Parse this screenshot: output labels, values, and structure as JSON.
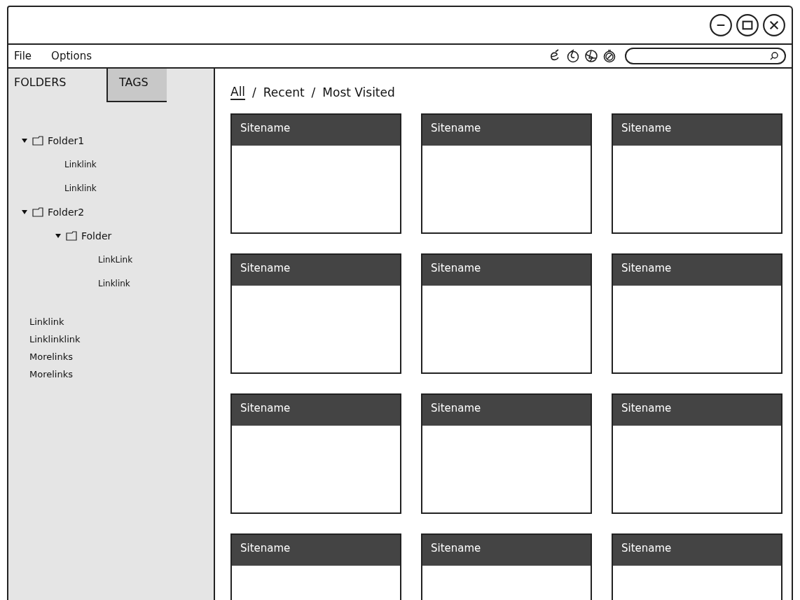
{
  "menu": [
    "File",
    "Options"
  ],
  "sidebar": {
    "tabs": [
      {
        "label": "FOLDERS",
        "selected": true
      },
      {
        "label": "TAGS",
        "selected": false
      }
    ],
    "tree": [
      {
        "kind": "folder",
        "label": "Folder1",
        "expanded": true,
        "children": [
          {
            "kind": "link",
            "label": "Linklink"
          },
          {
            "kind": "link",
            "label": "Linklink"
          }
        ]
      },
      {
        "kind": "folder",
        "label": "Folder2",
        "expanded": true,
        "children": [
          {
            "kind": "folder",
            "label": "Folder",
            "expanded": true,
            "children": [
              {
                "kind": "link",
                "label": "LinkLink"
              },
              {
                "kind": "link",
                "label": "Linklink"
              }
            ]
          }
        ]
      }
    ],
    "links": [
      "Linklink",
      "Linklinklink",
      "Morelinks",
      "Morelinks"
    ]
  },
  "filters": [
    {
      "kind": "tab",
      "label": "All",
      "selected": true
    },
    {
      "kind": "separator",
      "label": "/"
    },
    {
      "kind": "tab",
      "label": "Recent",
      "selected": false
    },
    {
      "kind": "separator",
      "label": "/"
    },
    {
      "kind": "tab",
      "label": "Most Visited",
      "selected": false
    }
  ],
  "sites": [
    {
      "title": "Sitename"
    },
    {
      "title": "Sitename"
    },
    {
      "title": "Sitename"
    },
    {
      "title": "Sitename"
    },
    {
      "title": "Sitename"
    },
    {
      "title": "Sitename"
    },
    {
      "title": "Sitename"
    },
    {
      "title": "Sitename"
    },
    {
      "title": "Sitename"
    },
    {
      "title": "Sitename"
    },
    {
      "title": "Sitename"
    },
    {
      "title": "Sitename"
    }
  ]
}
